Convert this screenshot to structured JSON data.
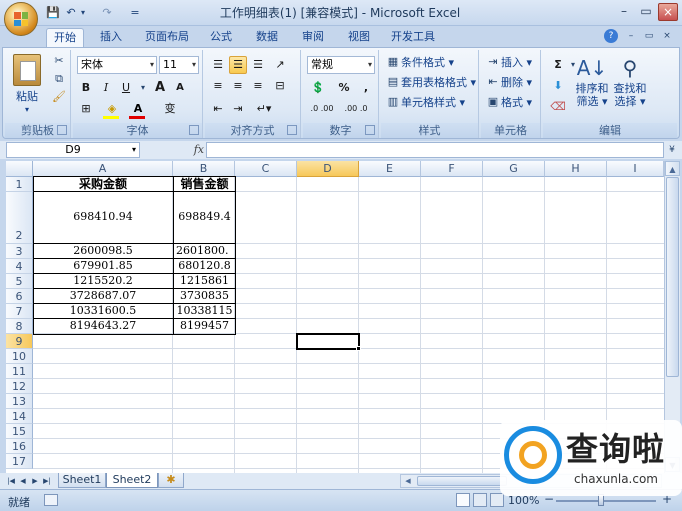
{
  "window": {
    "title": "工作明细表(1)  [兼容模式] - Microsoft Excel",
    "qat": {
      "save": "💾",
      "undo": "↶",
      "redo": "↷",
      "customize": "="
    },
    "controls": {
      "minimize": "–",
      "maximize": "▭",
      "close": "×"
    }
  },
  "ribbon": {
    "tabs": [
      "开始",
      "插入",
      "页面布局",
      "公式",
      "数据",
      "审阅",
      "视图",
      "开发工具"
    ],
    "active_tab": "开始",
    "help_icon": "?",
    "clipboard": {
      "label": "剪贴板",
      "paste": "粘贴"
    },
    "font": {
      "label": "字体",
      "name": "宋体",
      "size": "11",
      "bold": "B",
      "italic": "I",
      "underline": "U",
      "grow": "A",
      "shrink": "A",
      "font_color": "A",
      "phonetic": "变"
    },
    "alignment": {
      "label": "对齐方式"
    },
    "number": {
      "label": "数字",
      "format": "常规",
      "percent": "%",
      "comma": ",",
      "inc": ".0 .00",
      "dec": ".00 .0"
    },
    "styles": {
      "label": "样式",
      "conditional": "条件格式",
      "table": "套用表格格式",
      "cell_styles": "单元格样式"
    },
    "cells": {
      "label": "单元格",
      "insert": "插入",
      "delete": "删除",
      "format": "格式"
    },
    "editing": {
      "label": "编辑",
      "sum": "Σ",
      "sort_filter_1": "排序和",
      "sort_filter_2": "筛选",
      "find_1": "查找和",
      "find_2": "选择"
    }
  },
  "formula_bar": {
    "name_box": "D9",
    "fx": "fx",
    "value": ""
  },
  "grid": {
    "columns": [
      "A",
      "B",
      "C",
      "D",
      "E",
      "F",
      "G",
      "H",
      "I"
    ],
    "rows": [
      "1",
      "2",
      "3",
      "4",
      "5",
      "6",
      "7",
      "8",
      "9",
      "10",
      "11",
      "12",
      "13",
      "14",
      "15",
      "16",
      "17"
    ],
    "selected_cell": "D9",
    "headers": [
      "采购金额",
      "销售金额"
    ],
    "data": [
      [
        "698410.94",
        "698849.4"
      ],
      [
        "2600098.5",
        "2601800."
      ],
      [
        "679901.85",
        "680120.8"
      ],
      [
        "1215520.2",
        "1215861"
      ],
      [
        "3728687.07",
        "3730835"
      ],
      [
        "10331600.5",
        "10338115"
      ],
      [
        "8194643.27",
        "8199457"
      ]
    ]
  },
  "sheets": {
    "tabs": [
      "Sheet1",
      "Sheet2"
    ],
    "active": "Sheet2",
    "new_icon": "✱"
  },
  "status": {
    "ready": "就绪",
    "zoom": "100%",
    "zoom_out": "−",
    "zoom_in": "+"
  },
  "watermark": {
    "title": "查询啦",
    "url": "chaxunla.com"
  }
}
